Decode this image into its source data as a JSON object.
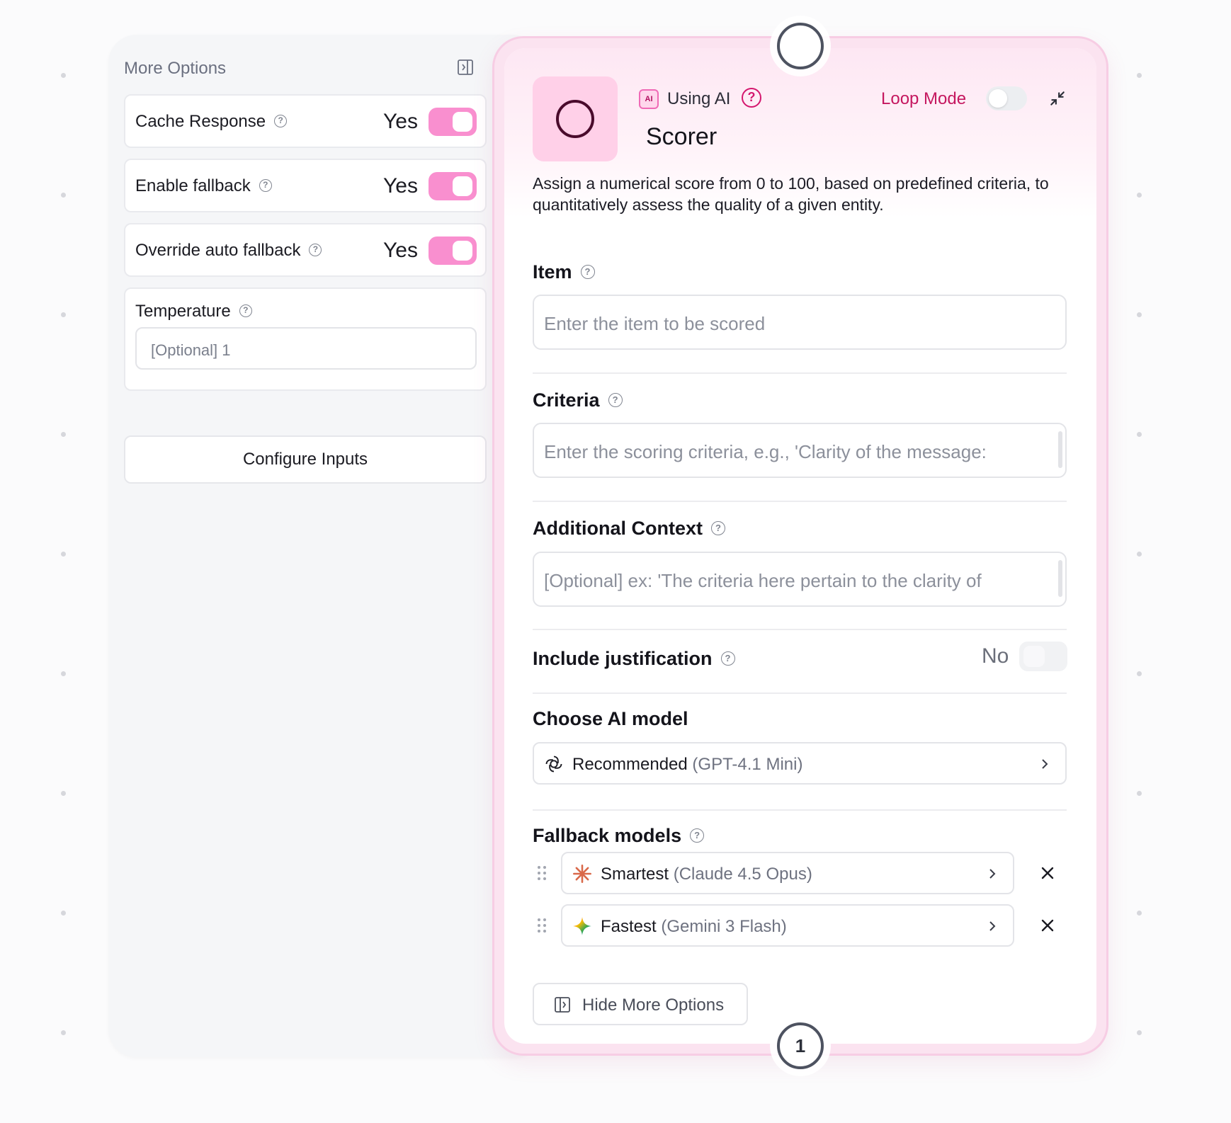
{
  "more_options": {
    "title": "More Options",
    "options": [
      {
        "label": "Cache Response",
        "value": "Yes"
      },
      {
        "label": "Enable fallback",
        "value": "Yes"
      },
      {
        "label": "Override auto fallback",
        "value": "Yes"
      }
    ],
    "temperature": {
      "label": "Temperature",
      "placeholder": "[Optional] 1"
    },
    "configure_inputs": "Configure Inputs"
  },
  "node": {
    "badge": "AI",
    "using_ai": "Using AI",
    "ai_help": "?",
    "loop_mode_label": "Loop Mode",
    "title": "Scorer",
    "description": "Assign a numerical score from 0 to 100, based on predefined criteria, to quantitatively assess the quality of a given entity.",
    "fields": {
      "item": {
        "label": "Item",
        "placeholder": "Enter the item to be scored"
      },
      "criteria": {
        "label": "Criteria",
        "placeholder": "Enter the scoring criteria, e.g., 'Clarity of the message:"
      },
      "context": {
        "label": "Additional Context",
        "placeholder": "[Optional] ex: 'The criteria here pertain to the clarity of"
      }
    },
    "justification": {
      "label": "Include justification",
      "value": "No"
    },
    "ai_model": {
      "label": "Choose AI model",
      "name": "Recommended",
      "detail": "(GPT-4.1 Mini)"
    },
    "fallback": {
      "label": "Fallback models",
      "models": [
        {
          "name": "Smartest",
          "detail": "(Claude 4.5 Opus)"
        },
        {
          "name": "Fastest",
          "detail": "(Gemini 3 Flash)"
        }
      ]
    },
    "hide_more_options": "Hide More Options"
  },
  "ports": {
    "output_number": "1"
  },
  "colors": {
    "accent": "#d4176e",
    "toggle_on": "#f98fcf",
    "card_tint": "#fbe3f0"
  }
}
